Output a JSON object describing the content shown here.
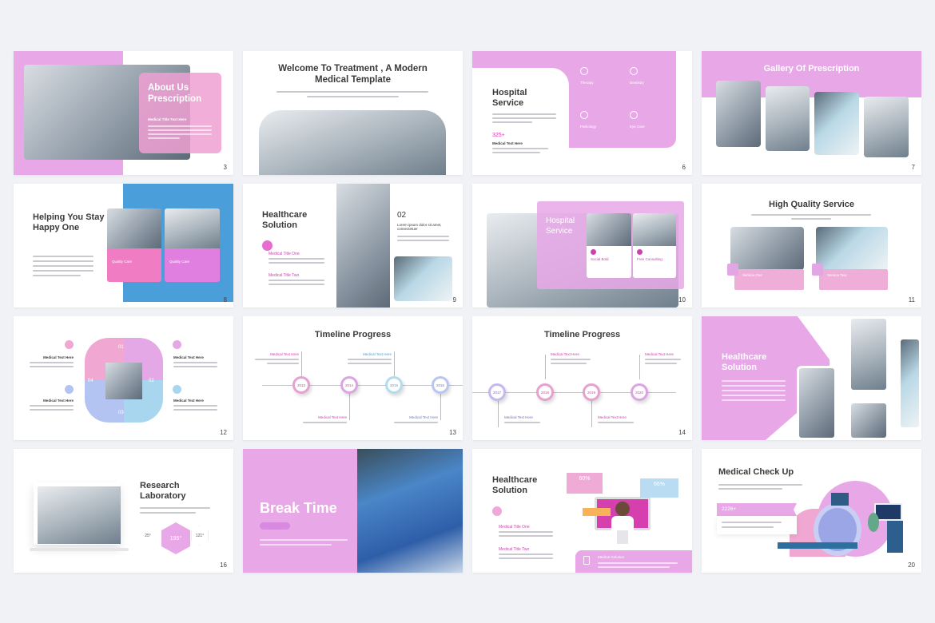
{
  "colors": {
    "pink": "#e8a8e8",
    "blue": "#4a9fdb",
    "magenta": "#d03fae",
    "title": "#3a3a3a"
  },
  "slides": {
    "s3": {
      "num": "3",
      "title": "About Us Prescription",
      "subtitle": "Medical Title Text Here"
    },
    "s4": {
      "title": "Welcome To Treatment , A Modern Medical Template"
    },
    "s6": {
      "num": "6",
      "title": "Hospital Service",
      "stat": "325+",
      "stat_label": "Medical Text Here",
      "services": [
        "Therapy",
        "Dentistry",
        "Pathology",
        "Eye Care"
      ]
    },
    "s7": {
      "num": "7",
      "title": "Gallery Of Prescription"
    },
    "s8": {
      "num": "8",
      "title": "Helping You Stay Happy One",
      "cards": [
        "Quality Care",
        "Quality Care"
      ]
    },
    "s9": {
      "num": "9",
      "title": "Healthcare Solution",
      "items": [
        "Medical Title One",
        "Medical Title Two"
      ],
      "step": "02",
      "step_text": "Lorem ipsum dolor sit amet, consectetuer"
    },
    "s10": {
      "num": "10",
      "title": "Hospital Service",
      "cards": [
        "Social Bold",
        "Free Consulting"
      ]
    },
    "s11": {
      "num": "11",
      "title": "High Quality Service",
      "cards": [
        "Service One",
        "Service Two"
      ]
    },
    "s12": {
      "num": "12",
      "steps": [
        "01",
        "02",
        "03",
        "04"
      ],
      "labels": [
        "Medical Text Here",
        "Medical Text Here",
        "Medical Text Here",
        "Medical Text Here"
      ]
    },
    "s13": {
      "num": "13",
      "title": "Timeline Progress",
      "years": [
        "2013",
        "2014",
        "2015",
        "2016"
      ],
      "labels": [
        "Medical Text Here",
        "Medical Text Here",
        "Medical Text Here",
        "Medical Text Here"
      ]
    },
    "s14": {
      "num": "14",
      "title": "Timeline Progress",
      "years": [
        "2017",
        "2018",
        "2019",
        "2020"
      ],
      "labels": [
        "Medical Text Here",
        "Medical Text Here",
        "Medical Text Here",
        "Medical Text Here"
      ]
    },
    "s15": {
      "title": "Healthcare Solution"
    },
    "s16": {
      "num": "16",
      "title": "Research Laboratory",
      "stats": [
        "25°",
        "195°",
        "121°"
      ]
    },
    "s17": {
      "title": "Break Time"
    },
    "s18": {
      "title": "Healthcare Solution",
      "items": [
        "Medical Title One",
        "Medical Title Two"
      ],
      "bubbles": [
        "60%",
        "66%"
      ],
      "panel": "Medical Solution"
    },
    "s20": {
      "num": "20",
      "title": "Medical Check Up",
      "stat": "2226+"
    }
  }
}
